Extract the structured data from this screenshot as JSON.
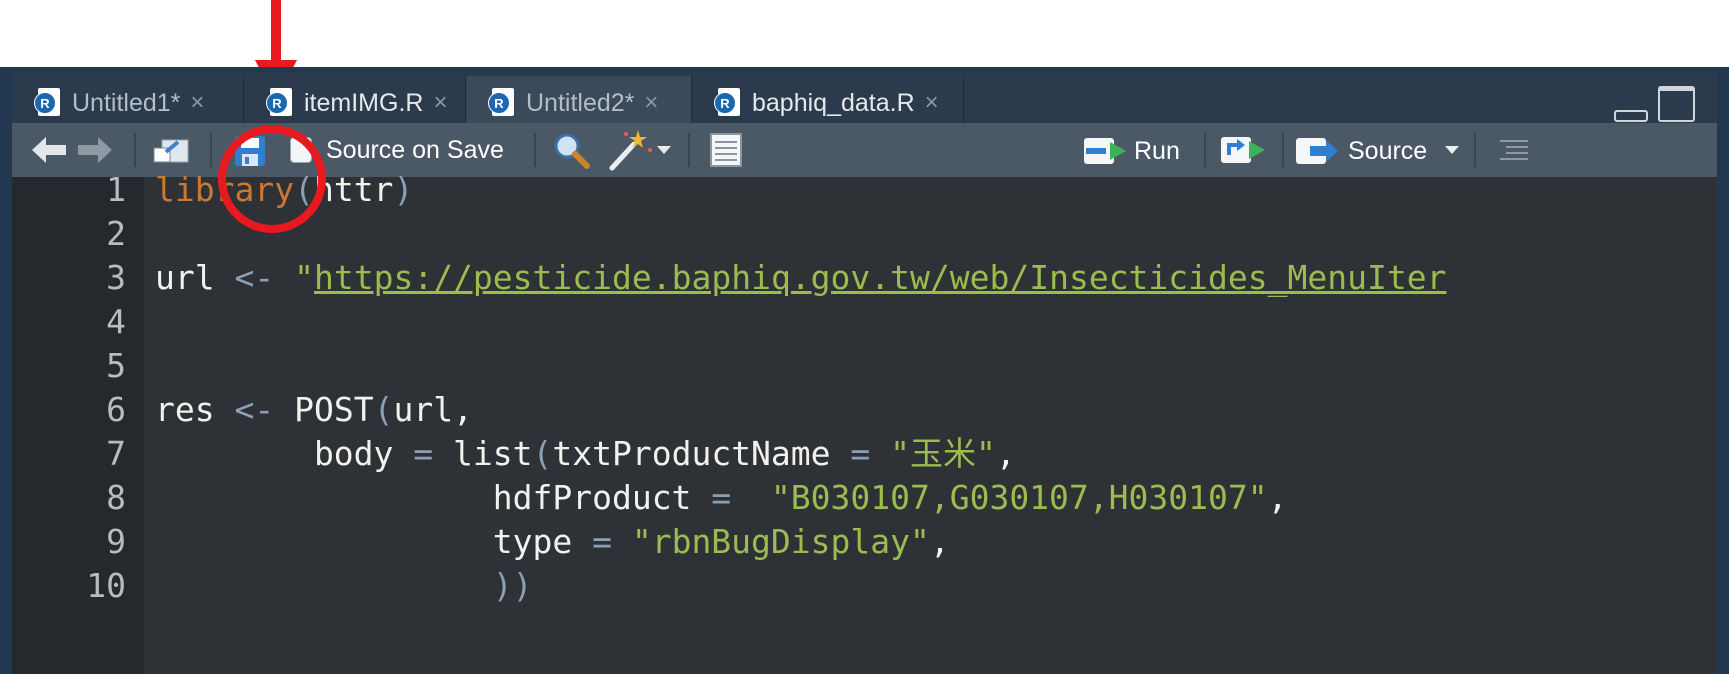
{
  "tabs": [
    {
      "label": "Untitled1*",
      "close": "×",
      "icon": "r-script-icon"
    },
    {
      "label": "itemIMG.R",
      "close": "×",
      "icon": "r-script-icon"
    },
    {
      "label": "Untitled2*",
      "close": "×",
      "icon": "r-script-icon"
    },
    {
      "label": "baphiq_data.R",
      "close": "×",
      "icon": "r-script-icon"
    }
  ],
  "tab_icon_letter": "R",
  "toolbar": {
    "source_on_save_label": "Source on Save",
    "run_label": "Run",
    "source_label": "Source"
  },
  "line_numbers": [
    "1",
    "2",
    "3",
    "4",
    "5",
    "6",
    "7",
    "8",
    "9",
    "10"
  ],
  "code": {
    "l1_fn": "library",
    "l1_open": "(",
    "l1_arg": "httr",
    "l1_close": ")",
    "l3_var": "url ",
    "l3_op": "<-",
    "l3_q": " \"",
    "l3_url": "https://pesticide.baphiq.gov.tw/web/Insecticides_MenuIter",
    "l6_var": "res ",
    "l6_op": "<-",
    "l6_fn": " POST",
    "l6_open": "(",
    "l6_rest": "url,",
    "l7_pre": "        body ",
    "l7_op": "=",
    "l7_fn": " list",
    "l7_open": "(",
    "l7_arg": "txtProductName ",
    "l7_op2": "=",
    "l7_str": " \"玉米\"",
    "l7_end": ",",
    "l8_pre": "                 hdfProduct ",
    "l8_op": "=",
    "l8_str": "  \"B030107,G030107,H030107\"",
    "l8_end": ",",
    "l9_pre": "                 type ",
    "l9_op": "=",
    "l9_str": " \"rbnBugDisplay\"",
    "l9_end": ",",
    "l10_pre": "                 ",
    "l10_close": "))"
  },
  "colors": {
    "annotation": "#e8191f",
    "tabbar_bg": "#2b3b4d",
    "toolbar_bg": "#4b5866",
    "editor_bg": "#2e3136",
    "keyword": "#cc7832",
    "string": "#9bbc4e",
    "operator": "#8aa0b6"
  }
}
